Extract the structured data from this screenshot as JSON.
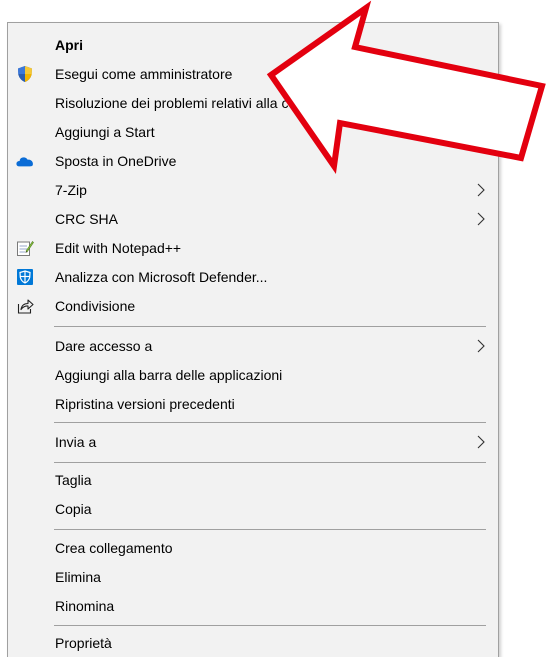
{
  "menu": {
    "items": [
      {
        "label": "Apri",
        "icon": null,
        "submenu": false,
        "bold": true
      },
      {
        "label": "Esegui come amministratore",
        "icon": "uac-shield-icon",
        "submenu": false
      },
      {
        "label": "Risoluzione dei problemi relativi alla compatibilità",
        "icon": null,
        "submenu": false
      },
      {
        "label": "Aggiungi a Start",
        "icon": null,
        "submenu": false
      },
      {
        "label": "Sposta in OneDrive",
        "icon": "onedrive-cloud-icon",
        "submenu": false
      },
      {
        "label": "7-Zip",
        "icon": null,
        "submenu": true
      },
      {
        "label": "CRC SHA",
        "icon": null,
        "submenu": true
      },
      {
        "label": "Edit with Notepad++",
        "icon": "notepad-plus-plus-icon",
        "submenu": false
      },
      {
        "label": "Analizza con Microsoft Defender...",
        "icon": "defender-shield-icon",
        "submenu": false
      },
      {
        "label": "Condivisione",
        "icon": "share-icon",
        "submenu": false
      },
      {
        "label": "Dare accesso a",
        "icon": null,
        "submenu": true
      },
      {
        "label": "Aggiungi alla barra delle applicazioni",
        "icon": null,
        "submenu": false
      },
      {
        "label": "Ripristina versioni precedenti",
        "icon": null,
        "submenu": false
      },
      {
        "label": "Invia a",
        "icon": null,
        "submenu": true
      },
      {
        "label": "Taglia",
        "icon": null,
        "submenu": false
      },
      {
        "label": "Copia",
        "icon": null,
        "submenu": false
      },
      {
        "label": "Crea collegamento",
        "icon": null,
        "submenu": false
      },
      {
        "label": "Elimina",
        "icon": null,
        "submenu": false
      },
      {
        "label": "Rinomina",
        "icon": null,
        "submenu": false
      },
      {
        "label": "Proprietà",
        "icon": null,
        "submenu": false
      }
    ]
  },
  "colors": {
    "menu_background": "#f2f2f2",
    "separator": "#a0a0a0",
    "callout_arrow_outline": "#e3000f",
    "callout_arrow_fill": "#ffffff"
  },
  "annotation": {
    "type": "arrow-callout",
    "points_to": "Esegui come amministratore"
  }
}
